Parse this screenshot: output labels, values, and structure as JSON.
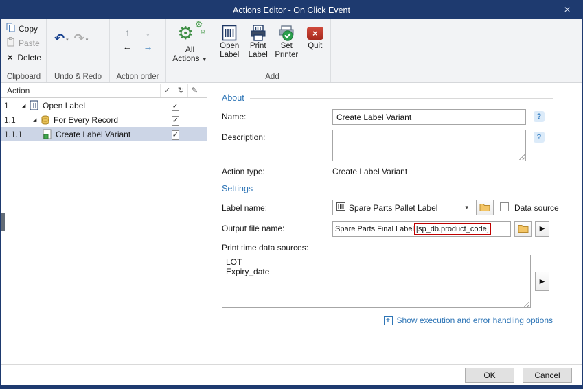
{
  "window": {
    "title": "Actions Editor - On Click Event"
  },
  "colors": {
    "titlebar": "#1e3a6f",
    "accent_blue": "#2e75b6",
    "annotation_red": "#c00000",
    "selection": "#ccd5e6",
    "gear_green": "#3e8e44",
    "quit_red": "#b23125"
  },
  "glyphs": {
    "close": "×",
    "delete": "×",
    "undo": "↶",
    "redo": "↷",
    "small_dropdown": "▾",
    "up": "↑",
    "down": "↓",
    "left": "←",
    "right": "→",
    "gear": "⚙",
    "dropdown": "▼",
    "check": "✓",
    "refresh": "↻",
    "pencil": "✎",
    "expander": "◢",
    "play": "▶",
    "help": "?",
    "plus": "+",
    "combo_arrow": "▾"
  },
  "ribbon": {
    "clipboard": {
      "copy_label": "Copy",
      "paste_label": "Paste",
      "delete_label": "Delete",
      "group_label": "Clipboard"
    },
    "undo_redo": {
      "group_label": "Undo & Redo"
    },
    "action_order": {
      "group_label": "Action order"
    },
    "all_actions": {
      "line1": "All",
      "line2": "Actions"
    },
    "add": {
      "group_label": "Add",
      "buttons": [
        {
          "line1": "Open",
          "line2": "Label"
        },
        {
          "line1": "Print",
          "line2": "Label"
        },
        {
          "line1": "Set",
          "line2": "Printer"
        },
        {
          "line1": "Quit",
          "line2": ""
        }
      ]
    }
  },
  "tree": {
    "header_label": "Action",
    "items": [
      {
        "number": "1",
        "label": "Open Label",
        "checked": true
      },
      {
        "number": "1.1",
        "label": "For Every Record",
        "checked": true
      },
      {
        "number": "1.1.1",
        "label": "Create Label Variant",
        "checked": true
      }
    ]
  },
  "form": {
    "about": {
      "header": "About",
      "name_label": "Name:",
      "name_value": "Create Label Variant",
      "description_label": "Description:",
      "description_value": "",
      "action_type_label": "Action type:",
      "action_type_value": "Create Label Variant"
    },
    "settings": {
      "header": "Settings",
      "label_name_label": "Label name:",
      "label_name_value": "Spare Parts Pallet Label",
      "data_source_label": "Data source",
      "output_file_label": "Output file name:",
      "output_file_value": "Spare Parts Final Label",
      "output_file_highlight": "[sp_db.product_code]",
      "print_time_label": "Print time data sources:",
      "print_time_value": "LOT\nExpiry_date",
      "options_link": "Show execution and error handling options"
    }
  },
  "footer": {
    "ok_label": "OK",
    "cancel_label": "Cancel"
  }
}
